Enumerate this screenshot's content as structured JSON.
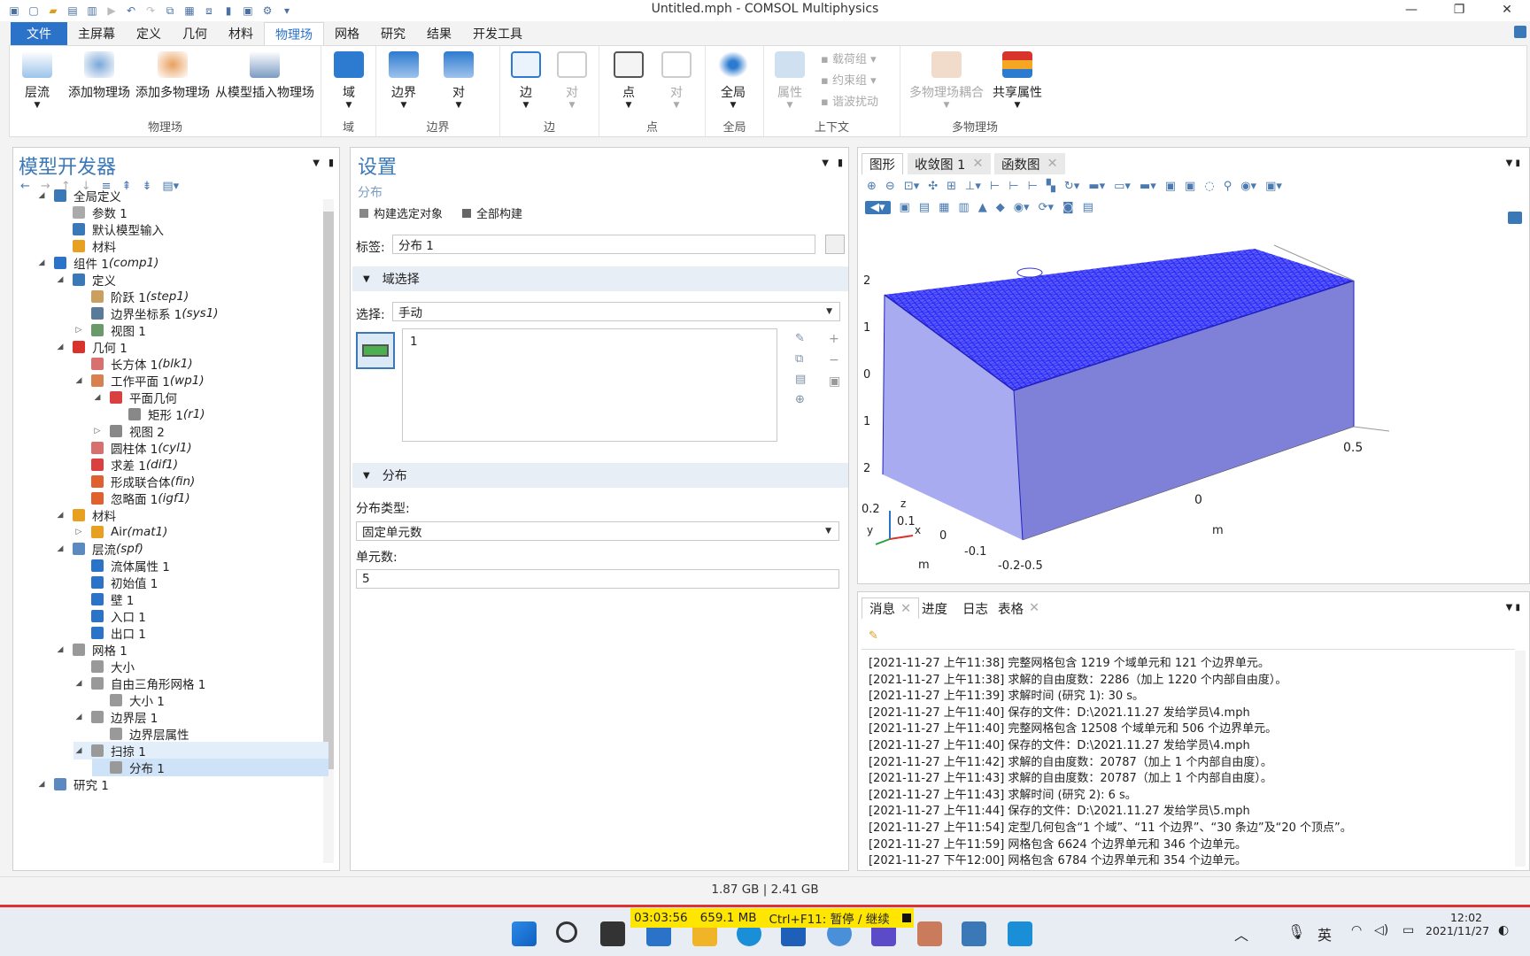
{
  "window": {
    "title": "Untitled.mph - COMSOL Multiphysics"
  },
  "menu": {
    "file": "文件",
    "tabs": [
      "主屏幕",
      "定义",
      "几何",
      "材料",
      "物理场",
      "网格",
      "研究",
      "结果",
      "开发工具"
    ],
    "active": "物理场"
  },
  "ribbon": {
    "g1": {
      "label": "物理场",
      "b1": "层流",
      "b2": "添加物理场",
      "b3": "添加多物理场",
      "b4": "从模型插入物理场"
    },
    "g2": {
      "label": "域",
      "b1": "域"
    },
    "g3": {
      "label": "边界",
      "b1": "边界",
      "b2": "对"
    },
    "g4": {
      "label": "边",
      "b1": "边",
      "b2": "对"
    },
    "g5": {
      "label": "点",
      "b1": "点",
      "b2": "对"
    },
    "g6": {
      "label": "全局",
      "b1": "全局"
    },
    "g7": {
      "label": "上下文",
      "b1": "属性",
      "s1": "载荷组",
      "s2": "约束组",
      "s3": "谐波扰动"
    },
    "g8": {
      "label": "多物理场",
      "b1": "多物理场耦合",
      "b2": "共享属性"
    }
  },
  "tree": {
    "title": "模型开发器",
    "nodes": [
      {
        "label": "全局定义",
        "tag": ""
      },
      {
        "label": "参数 1",
        "tag": ""
      },
      {
        "label": "默认模型输入",
        "tag": ""
      },
      {
        "label": "材料",
        "tag": ""
      },
      {
        "label": "组件 1 ",
        "tag": "(comp1)"
      },
      {
        "label": "定义",
        "tag": ""
      },
      {
        "label": "阶跃 1 ",
        "tag": "(step1)"
      },
      {
        "label": "边界坐标系 1 ",
        "tag": "(sys1)"
      },
      {
        "label": "视图 1",
        "tag": ""
      },
      {
        "label": "几何 1",
        "tag": ""
      },
      {
        "label": "长方体 1 ",
        "tag": "(blk1)"
      },
      {
        "label": "工作平面 1 ",
        "tag": "(wp1)"
      },
      {
        "label": "平面几何",
        "tag": ""
      },
      {
        "label": "矩形 1 ",
        "tag": "(r1)"
      },
      {
        "label": "视图 2",
        "tag": ""
      },
      {
        "label": "圆柱体 1 ",
        "tag": "(cyl1)"
      },
      {
        "label": "求差 1 ",
        "tag": "(dif1)"
      },
      {
        "label": "形成联合体 ",
        "tag": "(fin)"
      },
      {
        "label": "忽略面 1 ",
        "tag": "(igf1)"
      },
      {
        "label": "材料",
        "tag": ""
      },
      {
        "label": "Air ",
        "tag": "(mat1)"
      },
      {
        "label": "层流 ",
        "tag": "(spf)"
      },
      {
        "label": "流体属性 1",
        "tag": ""
      },
      {
        "label": "初始值 1",
        "tag": ""
      },
      {
        "label": "壁 1",
        "tag": ""
      },
      {
        "label": "入口 1",
        "tag": ""
      },
      {
        "label": "出口 1",
        "tag": ""
      },
      {
        "label": "网格 1",
        "tag": ""
      },
      {
        "label": "大小",
        "tag": ""
      },
      {
        "label": "自由三角形网格 1",
        "tag": ""
      },
      {
        "label": "大小 1",
        "tag": ""
      },
      {
        "label": "边界层 1",
        "tag": ""
      },
      {
        "label": "边界层属性",
        "tag": ""
      },
      {
        "label": "扫掠 1",
        "tag": ""
      },
      {
        "label": "分布 1",
        "tag": ""
      },
      {
        "label": "研究 1",
        "tag": ""
      }
    ]
  },
  "settings": {
    "title": "设置",
    "subtitle": "分布",
    "build_selected": "构建选定对象",
    "build_all": "全部构建",
    "label_caption": "标签:",
    "label_value": "分布 1",
    "sec_domain": "域选择",
    "selection_caption": "选择:",
    "selection_value": "手动",
    "selection_list": "1",
    "sec_dist": "分布",
    "dist_type_caption": "分布类型:",
    "dist_type_value": "固定单元数",
    "elements_caption": "单元数:",
    "elements_value": "5"
  },
  "graphics": {
    "tabs": [
      "图形",
      "收敛图 1",
      "函数图"
    ],
    "axis_labels": [
      "2",
      "1",
      "0",
      "1",
      "2",
      "0.5",
      "0",
      "0.2",
      "0.1",
      "0",
      "-0.1",
      "-0.2-0.5",
      "m",
      "m",
      "z",
      "y",
      "x"
    ]
  },
  "messages": {
    "tabs": [
      "消息",
      "进度",
      "日志",
      "表格"
    ],
    "lines": [
      "[2021-11-27 上午11:38] 完整网格包含 1219 个域单元和 121 个边界单元。",
      "[2021-11-27 上午11:38] 求解的自由度数：2286（加上 1220 个内部自由度）。",
      "[2021-11-27 上午11:39] 求解时间 (研究 1): 30 s。",
      "[2021-11-27 上午11:40] 保存的文件：D:\\2021.11.27 发给学员\\4.mph",
      "[2021-11-27 上午11:40] 完整网格包含 12508 个域单元和 506 个边界单元。",
      "[2021-11-27 上午11:40] 保存的文件：D:\\2021.11.27 发给学员\\4.mph",
      "[2021-11-27 上午11:42] 求解的自由度数：20787（加上 1 个内部自由度）。",
      "[2021-11-27 上午11:43] 求解的自由度数：20787（加上 1 个内部自由度）。",
      "[2021-11-27 上午11:43] 求解时间 (研究 2): 6 s。",
      "[2021-11-27 上午11:44] 保存的文件：D:\\2021.11.27 发给学员\\5.mph",
      "[2021-11-27 上午11:54] 定型几何包含“1 个域”、“11 个边界”、“30 条边”及“20 个顶点”。",
      "[2021-11-27 上午11:59] 网格包含 6624 个边界单元和 346 个边单元。",
      "[2021-11-27 下午12:00] 网格包含 6784 个边界单元和 354 个边单元。"
    ]
  },
  "status": {
    "memory": "1.87 GB | 2.41 GB"
  },
  "recorder": {
    "time": "03:03:56",
    "size": "659.1 MB",
    "hint": "Ctrl+F11: 暂停 / 继续"
  },
  "taskbar": {
    "ime": "英",
    "clock_time": "12:02",
    "clock_date": "2021/11/27"
  },
  "colors": {
    "accent": "#2b73c9",
    "mesh": "#1a1aff",
    "box_front": "#a9abf0",
    "box_side": "#7f80d8"
  }
}
